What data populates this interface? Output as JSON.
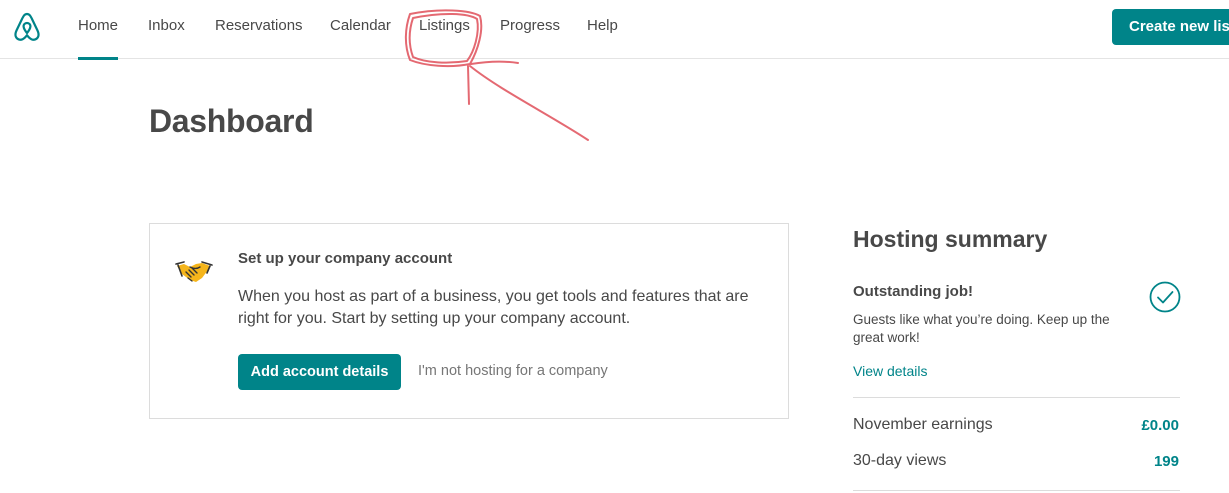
{
  "nav": {
    "items": [
      {
        "id": "home",
        "label": "Home",
        "active": true
      },
      {
        "id": "inbox",
        "label": "Inbox"
      },
      {
        "id": "reservations",
        "label": "Reservations"
      },
      {
        "id": "calendar",
        "label": "Calendar"
      },
      {
        "id": "listings",
        "label": "Listings"
      },
      {
        "id": "progress",
        "label": "Progress"
      },
      {
        "id": "help",
        "label": "Help"
      }
    ],
    "create_button": "Create new listing"
  },
  "page": {
    "title": "Dashboard"
  },
  "company_card": {
    "icon": "handshake-icon",
    "heading": "Set up your company account",
    "body": "When you host as part of a business, you get tools and features that are right for you. Start by setting up your company account.",
    "primary_button": "Add account details",
    "secondary_link": "I'm not hosting for a company"
  },
  "hosting_summary": {
    "title": "Hosting summary",
    "status_title": "Outstanding job!",
    "status_icon": "check-circle-icon",
    "status_desc": "Guests like what you’re doing. Keep up the great work!",
    "view_link": "View details",
    "stats": [
      {
        "label": "November earnings",
        "value": "£0.00"
      },
      {
        "label": "30-day views",
        "value": "199"
      }
    ]
  },
  "colors": {
    "accent": "#008489",
    "text": "#484848",
    "annotation": "#e0505a",
    "handshake": "#f5b51b"
  }
}
